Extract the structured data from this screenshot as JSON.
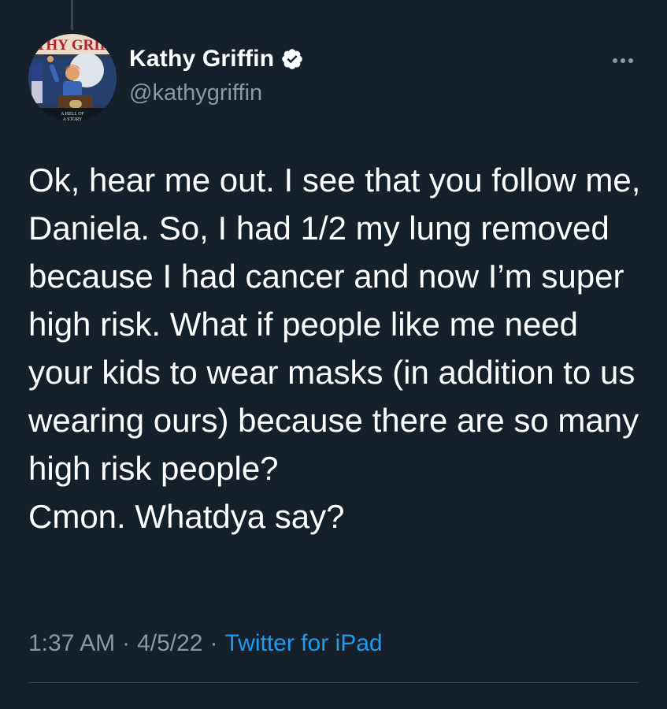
{
  "author": {
    "display_name": "Kathy Griffin",
    "handle": "@kathygriffin",
    "verified": true,
    "avatar_banner_text": "THY GRIF",
    "avatar_caption": "A HELL OF A STORY"
  },
  "tweet": {
    "text": "Ok, hear me out. I see that you follow me, Daniela. So, I had 1/2 my lung removed because I had cancer and now I’m super high risk. What if people like me need your kids to wear masks (in addition to us wearing ours) because there are so many high risk people?\nCmon. Whatdya say?",
    "time": "1:37 AM",
    "date": "4/5/22",
    "source": "Twitter for iPad",
    "separator": "·"
  },
  "icons": {
    "verified": "verified-badge-icon",
    "more": "more-options-icon"
  },
  "colors": {
    "background": "#15202b",
    "text": "#ffffff",
    "secondary_text": "#8899a6",
    "accent": "#1d9bf0",
    "divider": "#38444d"
  }
}
